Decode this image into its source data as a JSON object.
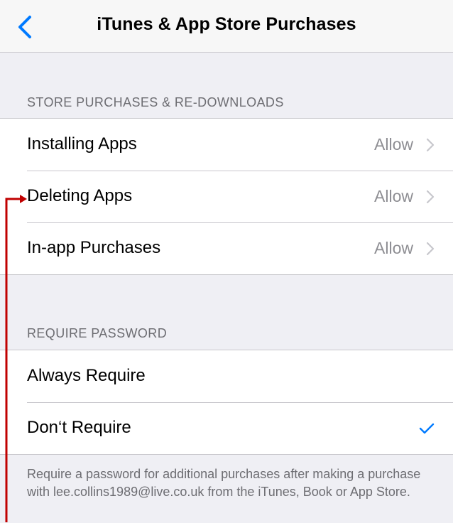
{
  "nav": {
    "title": "iTunes & App Store Purchases",
    "back_icon": "chevron-left-icon"
  },
  "store_section": {
    "header": "STORE PURCHASES & RE-DOWNLOADS",
    "rows": [
      {
        "label": "Installing Apps",
        "value": "Allow"
      },
      {
        "label": "Deleting Apps",
        "value": "Allow"
      },
      {
        "label": "In-app Purchases",
        "value": "Allow"
      }
    ]
  },
  "password_section": {
    "header": "REQUIRE PASSWORD",
    "rows": [
      {
        "label": "Always Require",
        "selected": false
      },
      {
        "label": "Don‘t Require",
        "selected": true
      }
    ],
    "footer": "Require a password for additional purchases after making a purchase with lee.collins1989@live.co.uk from the iTunes, Book or App Store."
  },
  "colors": {
    "accent": "#007aff",
    "annotation": "#c00000",
    "background": "#efeff4"
  }
}
